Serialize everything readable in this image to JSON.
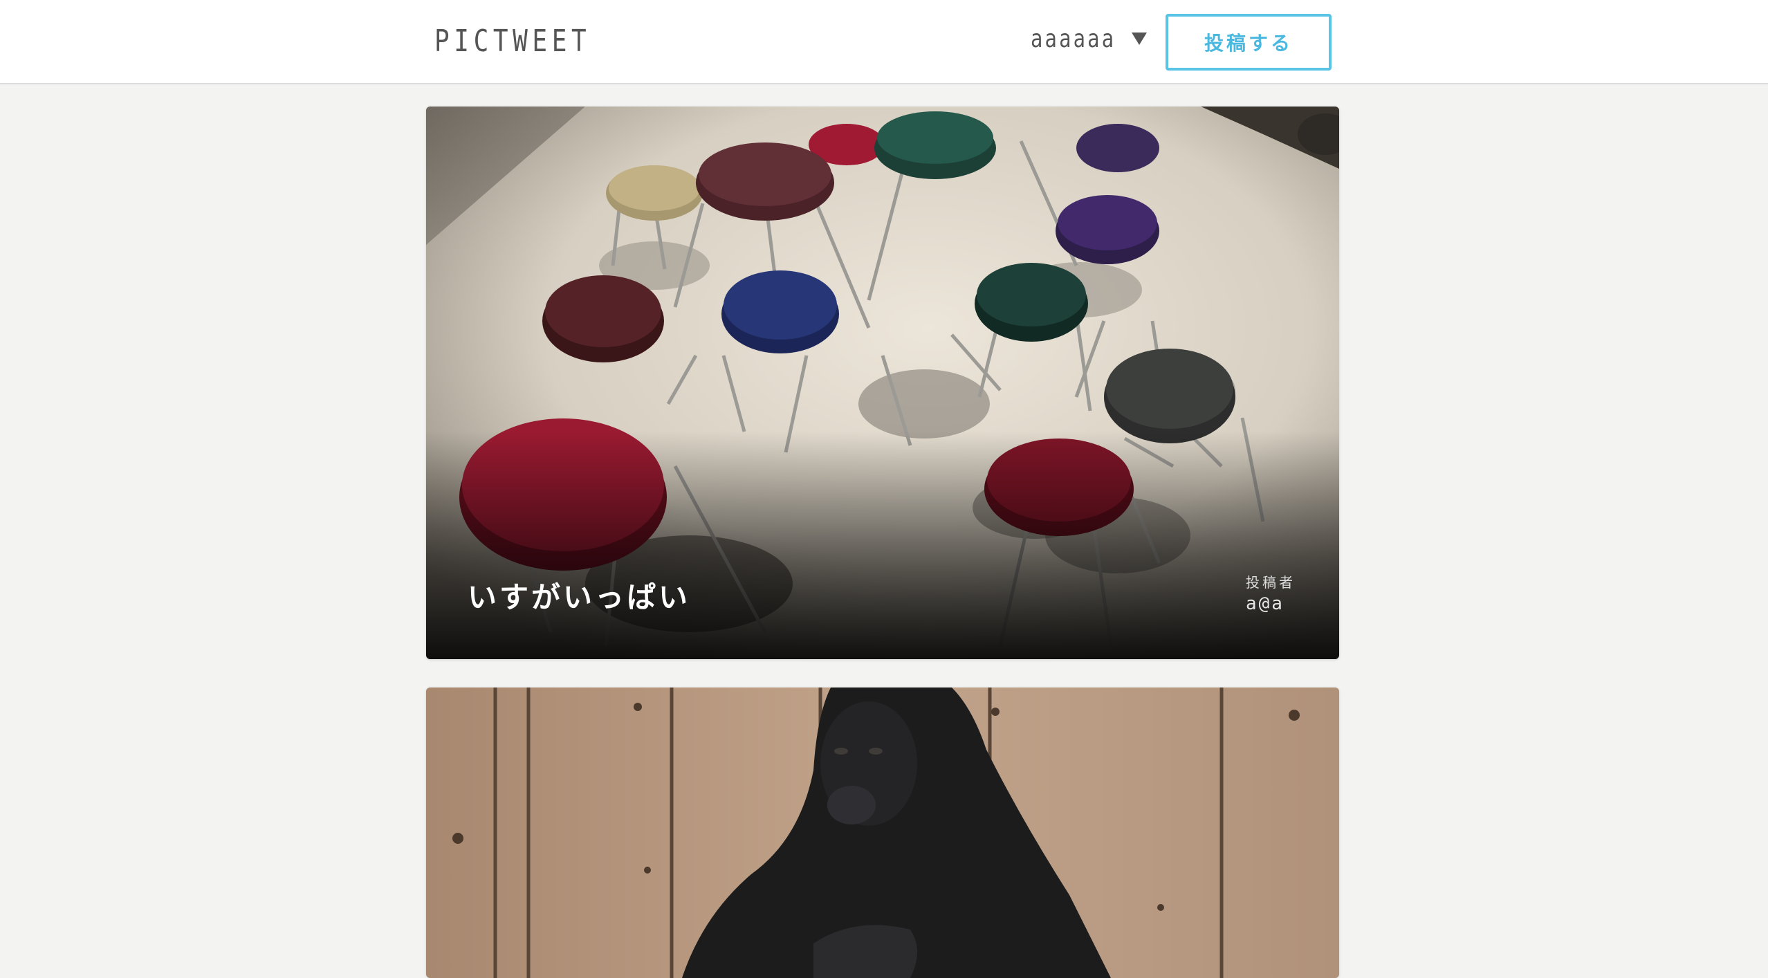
{
  "header": {
    "logo": "PICTWEET",
    "user_name": "aaaaaa",
    "post_button": "投稿する"
  },
  "posts": [
    {
      "title": "いすがいっぱい",
      "author_label": "投稿者",
      "author": "a@a",
      "image": "stools-photo"
    },
    {
      "title": "",
      "author_label": "",
      "author": "",
      "image": "gorilla-photo"
    }
  ],
  "colors": {
    "background": "#f3f3f1",
    "header_bg": "#ffffff",
    "accent": "#5ac4e6",
    "logo_text": "#555555"
  }
}
